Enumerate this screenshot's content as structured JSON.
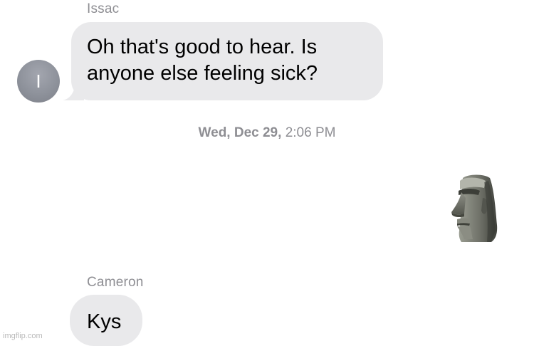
{
  "conversation": {
    "messages": [
      {
        "sender": "Issac",
        "avatar_initial": "I",
        "text_lines": [
          "Oh that's good to hear. Is",
          "anyone else feeling sick?"
        ]
      },
      {
        "sender": "Cameron",
        "text": "Kys"
      }
    ],
    "timestamp": {
      "date": "Wed, Dec 29,",
      "time": "2:06 PM"
    },
    "sticker": {
      "icon": "moai-icon"
    }
  },
  "watermark": "imgflip.com",
  "colors": {
    "bubble_incoming": "#e9e9eb",
    "meta_text": "#8e8e93",
    "avatar": "#8e929b",
    "background": "#ffffff"
  }
}
